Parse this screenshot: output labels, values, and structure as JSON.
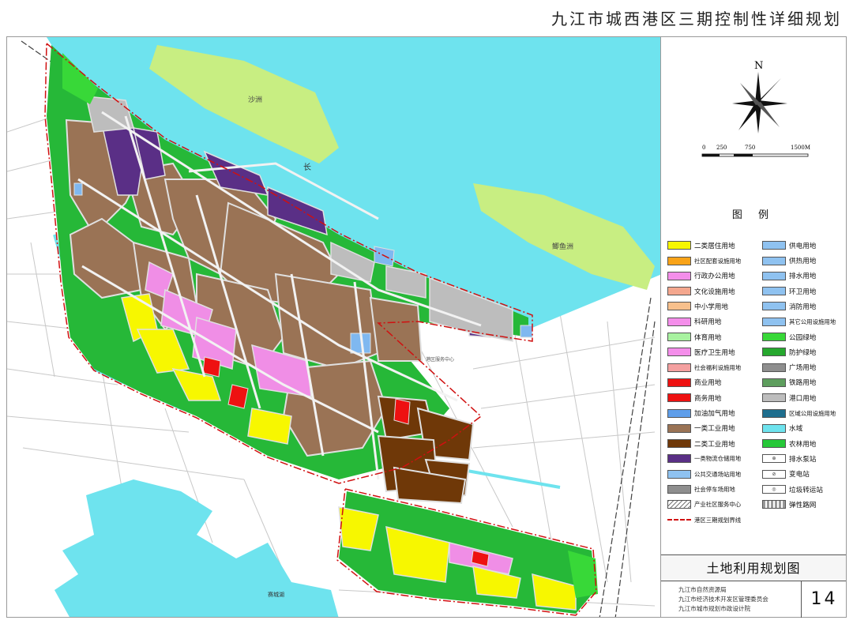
{
  "document": {
    "title": "九江市城西港区三期控制性详细规划"
  },
  "map": {
    "labels": {
      "north_island": "沙洲",
      "east_island": "鲫鱼洲",
      "river": "长",
      "lake": "赛城湖",
      "center": "港区服务中心"
    },
    "colors": {
      "water": "#6EE3EE",
      "island": "#C8EE82",
      "green": "#26B838",
      "industry1": "#9A7355",
      "industry2": "#6F3808",
      "logistics": "#5A2F86",
      "residential": "#F7F700",
      "science": "#F08EE6",
      "commercial": "#EE1111",
      "port": "#BDBDBD",
      "utility": "#7FB8F0",
      "road": "#E8E8E8",
      "boundary": "#D01010"
    }
  },
  "compass": {
    "north": "N"
  },
  "scale_bar": {
    "ticks": [
      "0",
      "250",
      "750",
      "1500M"
    ]
  },
  "legend": {
    "title": "图  例",
    "items": [
      {
        "code": "R2",
        "label": "二类居住用地",
        "color": "#F7F700"
      },
      {
        "code": "U12",
        "label": "供电用地",
        "color": "#8FC2F0"
      },
      {
        "code": "Rc2",
        "label": "社区配套设施用地",
        "color": "#F9A318"
      },
      {
        "code": "U14",
        "label": "供热用地",
        "color": "#8FC2F0"
      },
      {
        "code": "A1",
        "label": "行政办公用地",
        "color": "#F48EEA"
      },
      {
        "code": "U21",
        "label": "排水用地",
        "color": "#8FC2F0"
      },
      {
        "code": "A2",
        "label": "文化设施用地",
        "color": "#F4A78E"
      },
      {
        "code": "U22",
        "label": "环卫用地",
        "color": "#8FC2F0"
      },
      {
        "code": "A33",
        "label": "中小学用地",
        "color": "#F8C08C"
      },
      {
        "code": "U31",
        "label": "消防用地",
        "color": "#8FC2F0"
      },
      {
        "code": "A35",
        "label": "科研用地",
        "color": "#F48EEA"
      },
      {
        "code": "U9",
        "label": "其它公用设施用地",
        "color": "#8FC2F0"
      },
      {
        "code": "A4",
        "label": "体育用地",
        "color": "#A8F2A0"
      },
      {
        "code": "G1",
        "label": "公园绿地",
        "color": "#38D838"
      },
      {
        "code": "A5",
        "label": "医疗卫生用地",
        "color": "#F48EEA"
      },
      {
        "code": "G2",
        "label": "防护绿地",
        "color": "#26A82E"
      },
      {
        "code": "A6",
        "label": "社会福利设施用地",
        "color": "#F4A0A0"
      },
      {
        "code": "G3",
        "label": "广场用地",
        "color": "#8E8E8E"
      },
      {
        "code": "B1",
        "label": "商业用地",
        "color": "#EE1111"
      },
      {
        "code": "H21",
        "label": "铁路用地",
        "color": "#5E9E5E"
      },
      {
        "code": "B2",
        "label": "商务用地",
        "color": "#EE1111"
      },
      {
        "code": "H24",
        "label": "港口用地",
        "color": "#BDBDBD"
      },
      {
        "code": "B41",
        "label": "加油加气用地",
        "color": "#5E9EEA"
      },
      {
        "code": "H3",
        "label": "区域公用设施用地",
        "color": "#1E6E8E"
      },
      {
        "code": "M1",
        "label": "一类工业用地",
        "color": "#9A7355"
      },
      {
        "code": "E1",
        "label": "水域",
        "color": "#6EE3EE"
      },
      {
        "code": "M2",
        "label": "二类工业用地",
        "color": "#6F3808"
      },
      {
        "code": "E2",
        "label": "农林用地",
        "color": "#26C838"
      },
      {
        "code": "W1",
        "label": "一类物流仓储用地",
        "color": "#5A2F86"
      },
      {
        "code": "pump",
        "label": "排水泵站",
        "color": "#FFFFFF"
      },
      {
        "code": "S41",
        "label": "公共交通场站用地",
        "color": "#8FC2F0"
      },
      {
        "code": "sub",
        "label": "变电站",
        "color": "#FFFFFF"
      },
      {
        "code": "S42",
        "label": "社会停车场用地",
        "color": "#8E8E8E"
      },
      {
        "code": "trans",
        "label": "垃圾转运站",
        "color": "#FFFFFF"
      },
      {
        "code": "hatch",
        "label": "产业社区服务中心",
        "color": "#FFFFFF"
      },
      {
        "code": "flex",
        "label": "弹性路网",
        "color": "#FFFFFF"
      },
      {
        "code": "bound",
        "label": "港区三期规划界线",
        "color": "#FFFFFF"
      }
    ]
  },
  "plan_name": "土地利用规划图",
  "authorities": [
    "九江市自然资源局",
    "九江市经济技术开发区管理委员会",
    "九江市城市规划市政设计院"
  ],
  "page_number": "14"
}
